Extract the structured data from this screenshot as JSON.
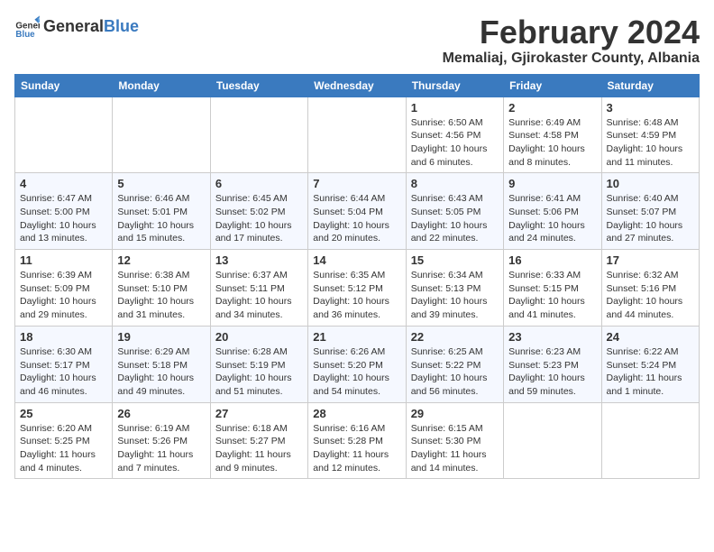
{
  "logo": {
    "general": "General",
    "blue": "Blue"
  },
  "header": {
    "month": "February 2024",
    "location": "Memaliaj, Gjirokaster County, Albania"
  },
  "weekdays": [
    "Sunday",
    "Monday",
    "Tuesday",
    "Wednesday",
    "Thursday",
    "Friday",
    "Saturday"
  ],
  "weeks": [
    [
      {
        "day": "",
        "info": ""
      },
      {
        "day": "",
        "info": ""
      },
      {
        "day": "",
        "info": ""
      },
      {
        "day": "",
        "info": ""
      },
      {
        "day": "1",
        "info": "Sunrise: 6:50 AM\nSunset: 4:56 PM\nDaylight: 10 hours\nand 6 minutes."
      },
      {
        "day": "2",
        "info": "Sunrise: 6:49 AM\nSunset: 4:58 PM\nDaylight: 10 hours\nand 8 minutes."
      },
      {
        "day": "3",
        "info": "Sunrise: 6:48 AM\nSunset: 4:59 PM\nDaylight: 10 hours\nand 11 minutes."
      }
    ],
    [
      {
        "day": "4",
        "info": "Sunrise: 6:47 AM\nSunset: 5:00 PM\nDaylight: 10 hours\nand 13 minutes."
      },
      {
        "day": "5",
        "info": "Sunrise: 6:46 AM\nSunset: 5:01 PM\nDaylight: 10 hours\nand 15 minutes."
      },
      {
        "day": "6",
        "info": "Sunrise: 6:45 AM\nSunset: 5:02 PM\nDaylight: 10 hours\nand 17 minutes."
      },
      {
        "day": "7",
        "info": "Sunrise: 6:44 AM\nSunset: 5:04 PM\nDaylight: 10 hours\nand 20 minutes."
      },
      {
        "day": "8",
        "info": "Sunrise: 6:43 AM\nSunset: 5:05 PM\nDaylight: 10 hours\nand 22 minutes."
      },
      {
        "day": "9",
        "info": "Sunrise: 6:41 AM\nSunset: 5:06 PM\nDaylight: 10 hours\nand 24 minutes."
      },
      {
        "day": "10",
        "info": "Sunrise: 6:40 AM\nSunset: 5:07 PM\nDaylight: 10 hours\nand 27 minutes."
      }
    ],
    [
      {
        "day": "11",
        "info": "Sunrise: 6:39 AM\nSunset: 5:09 PM\nDaylight: 10 hours\nand 29 minutes."
      },
      {
        "day": "12",
        "info": "Sunrise: 6:38 AM\nSunset: 5:10 PM\nDaylight: 10 hours\nand 31 minutes."
      },
      {
        "day": "13",
        "info": "Sunrise: 6:37 AM\nSunset: 5:11 PM\nDaylight: 10 hours\nand 34 minutes."
      },
      {
        "day": "14",
        "info": "Sunrise: 6:35 AM\nSunset: 5:12 PM\nDaylight: 10 hours\nand 36 minutes."
      },
      {
        "day": "15",
        "info": "Sunrise: 6:34 AM\nSunset: 5:13 PM\nDaylight: 10 hours\nand 39 minutes."
      },
      {
        "day": "16",
        "info": "Sunrise: 6:33 AM\nSunset: 5:15 PM\nDaylight: 10 hours\nand 41 minutes."
      },
      {
        "day": "17",
        "info": "Sunrise: 6:32 AM\nSunset: 5:16 PM\nDaylight: 10 hours\nand 44 minutes."
      }
    ],
    [
      {
        "day": "18",
        "info": "Sunrise: 6:30 AM\nSunset: 5:17 PM\nDaylight: 10 hours\nand 46 minutes."
      },
      {
        "day": "19",
        "info": "Sunrise: 6:29 AM\nSunset: 5:18 PM\nDaylight: 10 hours\nand 49 minutes."
      },
      {
        "day": "20",
        "info": "Sunrise: 6:28 AM\nSunset: 5:19 PM\nDaylight: 10 hours\nand 51 minutes."
      },
      {
        "day": "21",
        "info": "Sunrise: 6:26 AM\nSunset: 5:20 PM\nDaylight: 10 hours\nand 54 minutes."
      },
      {
        "day": "22",
        "info": "Sunrise: 6:25 AM\nSunset: 5:22 PM\nDaylight: 10 hours\nand 56 minutes."
      },
      {
        "day": "23",
        "info": "Sunrise: 6:23 AM\nSunset: 5:23 PM\nDaylight: 10 hours\nand 59 minutes."
      },
      {
        "day": "24",
        "info": "Sunrise: 6:22 AM\nSunset: 5:24 PM\nDaylight: 11 hours\nand 1 minute."
      }
    ],
    [
      {
        "day": "25",
        "info": "Sunrise: 6:20 AM\nSunset: 5:25 PM\nDaylight: 11 hours\nand 4 minutes."
      },
      {
        "day": "26",
        "info": "Sunrise: 6:19 AM\nSunset: 5:26 PM\nDaylight: 11 hours\nand 7 minutes."
      },
      {
        "day": "27",
        "info": "Sunrise: 6:18 AM\nSunset: 5:27 PM\nDaylight: 11 hours\nand 9 minutes."
      },
      {
        "day": "28",
        "info": "Sunrise: 6:16 AM\nSunset: 5:28 PM\nDaylight: 11 hours\nand 12 minutes."
      },
      {
        "day": "29",
        "info": "Sunrise: 6:15 AM\nSunset: 5:30 PM\nDaylight: 11 hours\nand 14 minutes."
      },
      {
        "day": "",
        "info": ""
      },
      {
        "day": "",
        "info": ""
      }
    ]
  ]
}
